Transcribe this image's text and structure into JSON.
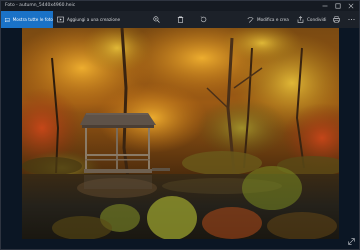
{
  "window": {
    "title": "Foto - autumn_5440x4960.heic",
    "controls": {
      "minimize_icon": "minimize-icon",
      "maximize_icon": "maximize-icon",
      "close_icon": "close-icon"
    }
  },
  "toolbar": {
    "primary_button": {
      "label": "Mostra tutte le foto",
      "icon": "photos-icon"
    },
    "add_creation": {
      "label": "Aggiungi a una creazione",
      "icon": "add-creation-icon"
    },
    "zoom_icon": "zoom-icon",
    "delete_icon": "trash-icon",
    "rotate_icon": "rotate-icon",
    "edit_create": {
      "label": "Modifica e crea",
      "icon": "edit-icon"
    },
    "share": {
      "label": "Condividi",
      "icon": "share-icon"
    },
    "print_icon": "print-icon",
    "more_icon": "more-icon"
  },
  "viewer": {
    "image_subject": "autumn lake with wooden gazebo",
    "fullscreen_icon": "fit-expand-icon"
  },
  "colors": {
    "accent": "#1a72c7",
    "background": "#0b1624",
    "toolbar": "#1c2129"
  }
}
